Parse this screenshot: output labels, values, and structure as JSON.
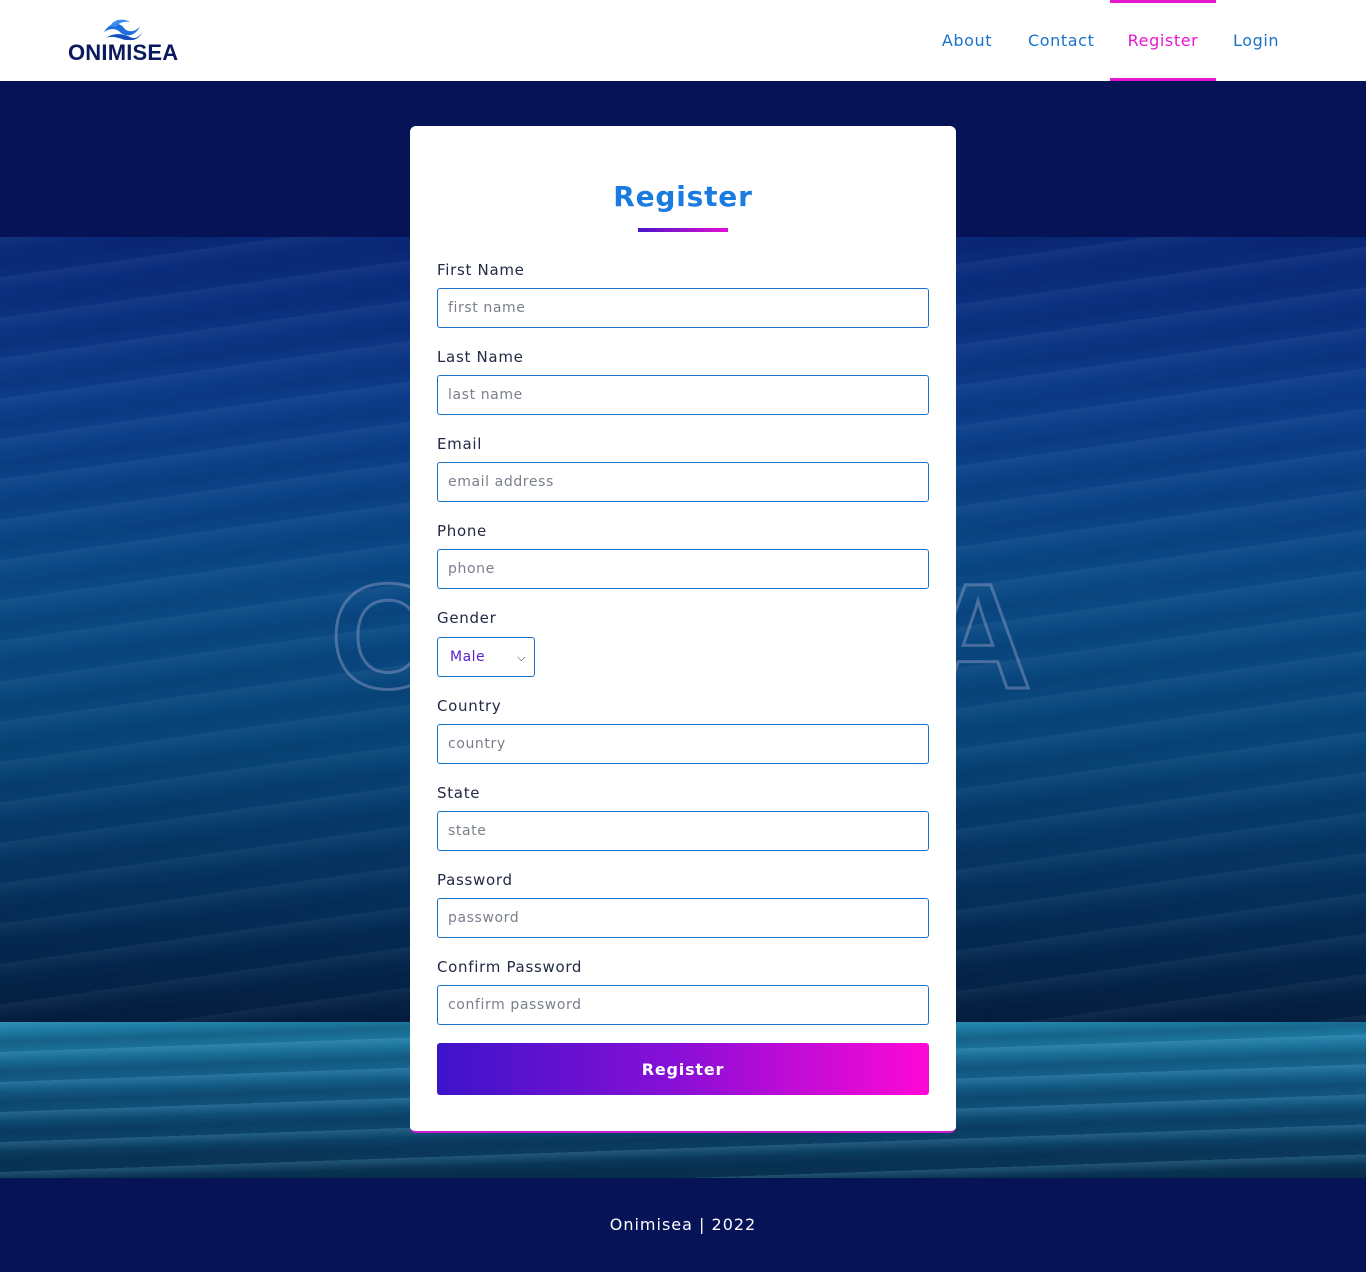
{
  "header": {
    "logo_text": "ONIMISEA",
    "nav": [
      {
        "label": "About",
        "active": false
      },
      {
        "label": "Contact",
        "active": false
      },
      {
        "label": "Register",
        "active": true
      },
      {
        "label": "Login",
        "active": false
      }
    ]
  },
  "background": {
    "watermark_text": "O          A"
  },
  "form": {
    "title": "Register",
    "fields": {
      "first_name": {
        "label": "First Name",
        "placeholder": "first name",
        "value": ""
      },
      "last_name": {
        "label": "Last Name",
        "placeholder": "last name",
        "value": ""
      },
      "email": {
        "label": "Email",
        "placeholder": "email address",
        "value": ""
      },
      "phone": {
        "label": "Phone",
        "placeholder": "phone",
        "value": ""
      },
      "gender": {
        "label": "Gender",
        "selected": "Male"
      },
      "country": {
        "label": "Country",
        "placeholder": "country",
        "value": ""
      },
      "state": {
        "label": "State",
        "placeholder": "state",
        "value": ""
      },
      "password": {
        "label": "Password",
        "placeholder": "password",
        "value": ""
      },
      "confirm_password": {
        "label": "Confirm Password",
        "placeholder": "confirm password",
        "value": ""
      }
    },
    "submit_label": "Register"
  },
  "footer": {
    "text": "Onimisea | 2022"
  },
  "colors": {
    "accent_blue": "#1a73c8",
    "accent_pink": "#e516d0",
    "navy": "#061357",
    "button_gradient_start": "#3d13c9",
    "button_gradient_end": "#ff08d6"
  },
  "icons": {
    "logo": "wave-logo-icon",
    "select": "chevron-down-icon"
  }
}
